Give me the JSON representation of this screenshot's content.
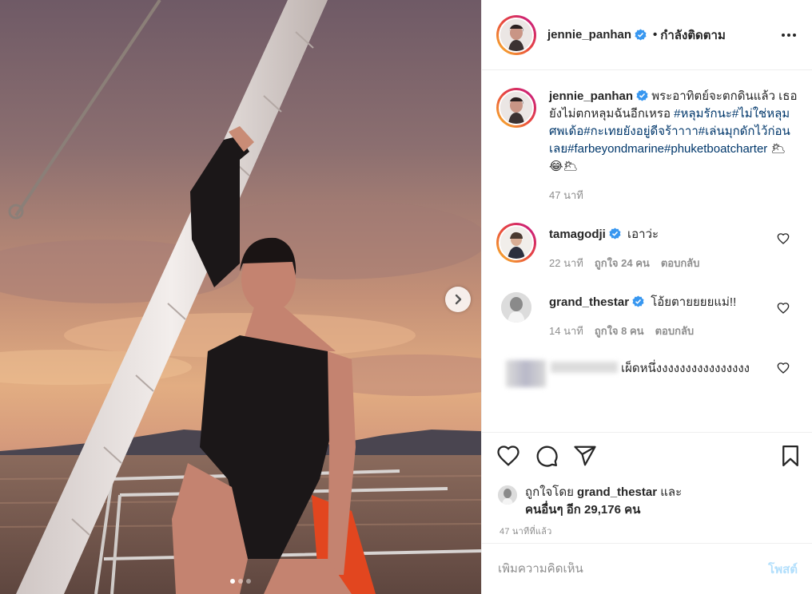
{
  "post_header": {
    "username": "jennie_panhan",
    "separator": "•",
    "following_label": "กำลังติดตาม",
    "more_icon": "more-horizontal-icon"
  },
  "caption": {
    "username": "jennie_panhan",
    "text_before_tags": "พระอาทิตย์จะตกดินแล้ว เธอยังไม่ตกหลุมฉันอีกเหรอ ",
    "hashtags": [
      "#หลุมรักนะ",
      "#ไม่ใช่หลุมศพเด้อ",
      "#กะเทยยังอยู่ดีจร้าาาา",
      "#เล่นมุกดักไว้ก่อนเลย",
      "#farbeyondmarine",
      "#phuketboatcharter"
    ],
    "emoji": "🌥😂🌥",
    "time": "47 นาที"
  },
  "comments": [
    {
      "username": "tamagodji",
      "text": "เอาว่ะ",
      "time": "22 นาที",
      "likes": "ถูกใจ 24 คน",
      "reply_label": "ตอบกลับ"
    },
    {
      "username": "grand_thestar",
      "text": "โอ้ยตายยยยแม่!!",
      "time": "14 นาที",
      "likes": "ถูกใจ 8 คน",
      "reply_label": "ตอบกลับ"
    },
    {
      "username": "",
      "text": "เผ็ดหนึ่งงงงงงงงงงงงงงงง"
    }
  ],
  "likes_summary": {
    "prefix": "ถูกใจโดย",
    "user": "grand_thestar",
    "conjunction": "และ",
    "others": "คนอื่นๆ อีก 29,176 คน"
  },
  "time_ago": "47 นาทีที่แล้ว",
  "add_comment": {
    "placeholder": "เพิ่มความคิดเห็น",
    "post_label": "โพสต์"
  },
  "carousel": {
    "slide_count": 3,
    "active_slide": 1
  },
  "colors": {
    "link": "#00376b",
    "muted": "#8e8e8e",
    "verified": "#3897f0",
    "post_button": "#b2dffc"
  }
}
